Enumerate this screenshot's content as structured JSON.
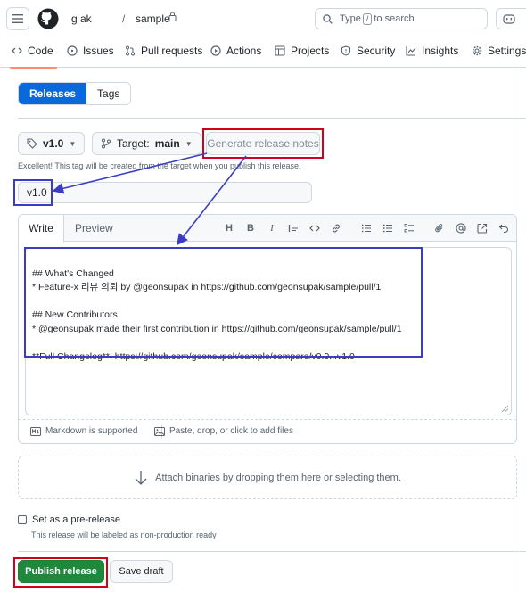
{
  "header": {
    "owner": "g         ak",
    "separator": "/",
    "repo": "sample",
    "search_placeholder_prefix": "Type",
    "search_key": "/",
    "search_placeholder_suffix": "to search"
  },
  "nav": {
    "code": "Code",
    "issues": "Issues",
    "pulls": "Pull requests",
    "actions": "Actions",
    "projects": "Projects",
    "security": "Security",
    "insights": "Insights",
    "settings": "Settings"
  },
  "subnav": {
    "releases": "Releases",
    "tags": "Tags"
  },
  "form": {
    "tag_value": "v1.0",
    "target_label": "Target:",
    "target_value": "main",
    "generate_label": "Generate release notes",
    "tag_hint": "Excellent! This tag will be created from the target when you publish this release.",
    "title_value": "v1.0"
  },
  "editor": {
    "tab_write": "Write",
    "tab_preview": "Preview",
    "toolbar": {
      "heading": "H",
      "bold": "B",
      "italic": "I"
    },
    "body_lines": [
      "## What's Changed",
      "* Feature-x 리뷰 의뢰 by @geonsupak in https://github.com/geonsupak/sample/pull/1",
      "",
      "## New Contributors",
      "* @geonsupak made their first contribution in https://github.com/geonsupak/sample/pull/1",
      "",
      "**Full Changelog**: https://github.com/geonsupak/sample/compare/v0.9...v1.0"
    ],
    "markdown_note": "Markdown is supported",
    "attach_note": "Paste, drop, or click to add files"
  },
  "dropzone": {
    "text": "Attach binaries by dropping them here or selecting them."
  },
  "prerelease": {
    "label": "Set as a pre-release",
    "note": "This release will be labeled as non-production ready"
  },
  "actions": {
    "publish": "Publish release",
    "draft": "Save draft"
  },
  "colors": {
    "primary": "#0969da",
    "publish_green": "#1f883d",
    "annotation_red": "#d0021b",
    "annotation_blue": "#3a3dc4"
  }
}
